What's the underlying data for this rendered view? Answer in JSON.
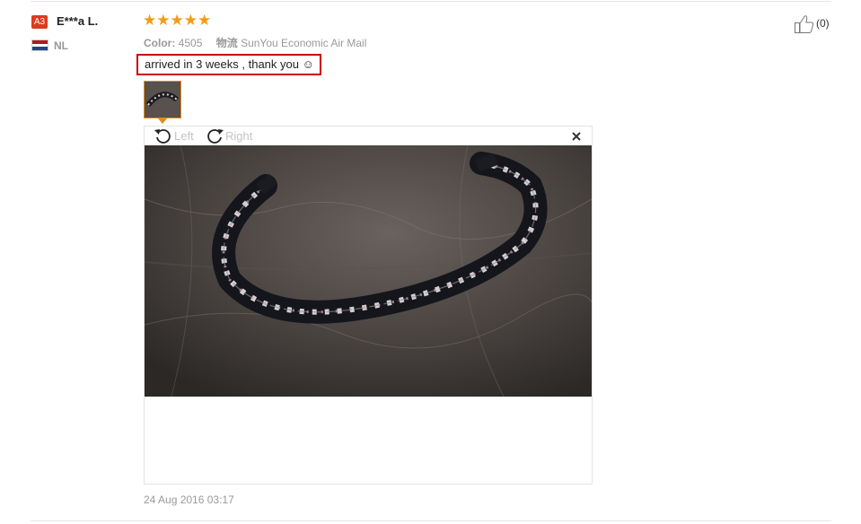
{
  "buyer": {
    "level_badge": "A3",
    "name": "E***a L.",
    "country_code": "NL",
    "flag_colors": [
      "#ae1c28",
      "#ffffff",
      "#21468b"
    ]
  },
  "review": {
    "rating": 5,
    "stars": "★★★★★",
    "star_color": "#f39c12",
    "color_label": "Color:",
    "color_value": "4505",
    "shipping_label": "物流",
    "shipping_value": "SunYou Economic Air Mail",
    "feedback_text": "arrived in 3 weeks , thank you ☺",
    "date": "24 Aug 2016 03:17"
  },
  "helpful": {
    "icon": "thumbs-up-icon",
    "count_text": "(0)"
  },
  "viewer": {
    "rotate_left_label": "Left",
    "rotate_right_label": "Right",
    "close_icon": "close-icon",
    "thumbnail_active_color": "#e38b1a"
  }
}
